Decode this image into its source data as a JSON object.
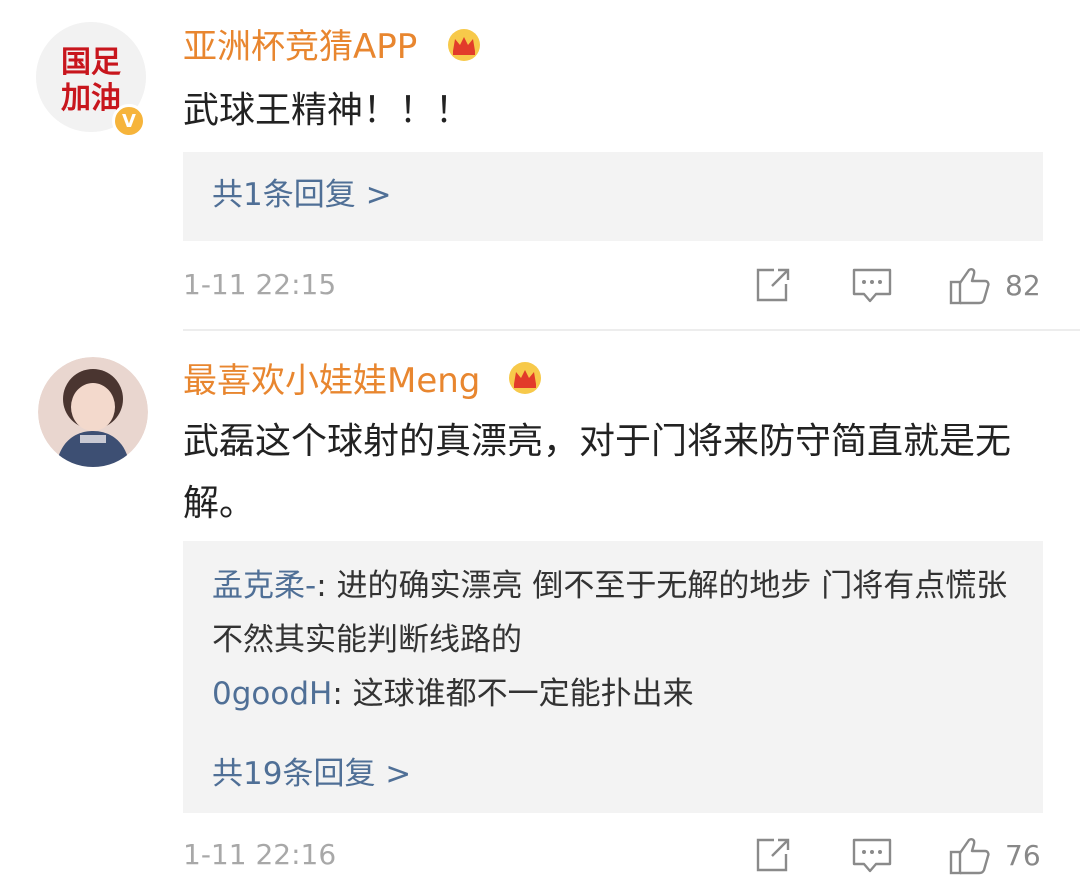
{
  "comments": [
    {
      "avatar_text": "国足加油",
      "verified_badge": "V",
      "username": "亚洲杯竞猜APP",
      "text": "武球王精神！！！",
      "reply_summary": "共1条回复 >",
      "time": "1-11 22:15",
      "likes": "82"
    },
    {
      "username": "最喜欢小娃娃Meng",
      "text": "武磊这个球射的真漂亮，对于门将来防守简直就是无解。",
      "replies": [
        {
          "user": "孟克柔-",
          "text": ": 进的确实漂亮 倒不至于无解的地步 门将有点慌张 不然其实能判断线路的"
        },
        {
          "user": "0goodH",
          "text": ": 这球谁都不一定能扑出来"
        }
      ],
      "reply_summary": "共19条回复 >",
      "time": "1-11 22:16",
      "likes": "76"
    }
  ],
  "icons": [
    "crown-icon",
    "share-icon",
    "comment-icon",
    "like-icon"
  ],
  "colors": {
    "username": "#e8862f",
    "link": "#4f6f96",
    "reply_bg": "#f3f3f3",
    "meta": "#a8a8a8"
  }
}
